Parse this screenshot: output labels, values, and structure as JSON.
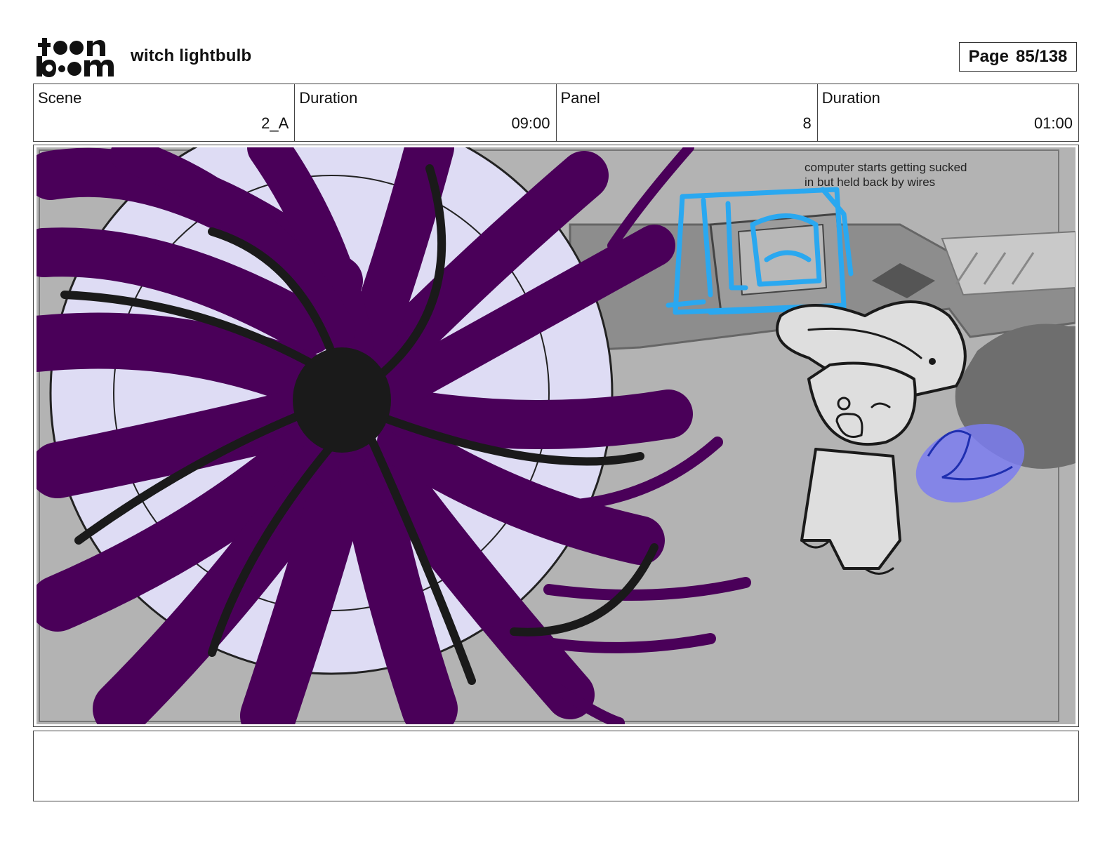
{
  "header": {
    "logo_text": "toon boom",
    "project_title": "witch lightbulb",
    "page_label": "Page",
    "page_value": "85/138"
  },
  "info": {
    "scene_label": "Scene",
    "scene_value": "2_A",
    "scene_duration_label": "Duration",
    "scene_duration_value": "09:00",
    "panel_label": "Panel",
    "panel_value": "8",
    "panel_duration_label": "Duration",
    "panel_duration_value": "01:00"
  },
  "panel": {
    "note": "computer starts getting sucked in but held back by wires"
  },
  "notes": {
    "text": ""
  },
  "colors": {
    "vortex": "#4a0059",
    "vortex_light": "#dedcf4",
    "wire_sketch": "#2aa8f0",
    "blob": "#7b7cf0",
    "background": "#b3b3b3"
  }
}
